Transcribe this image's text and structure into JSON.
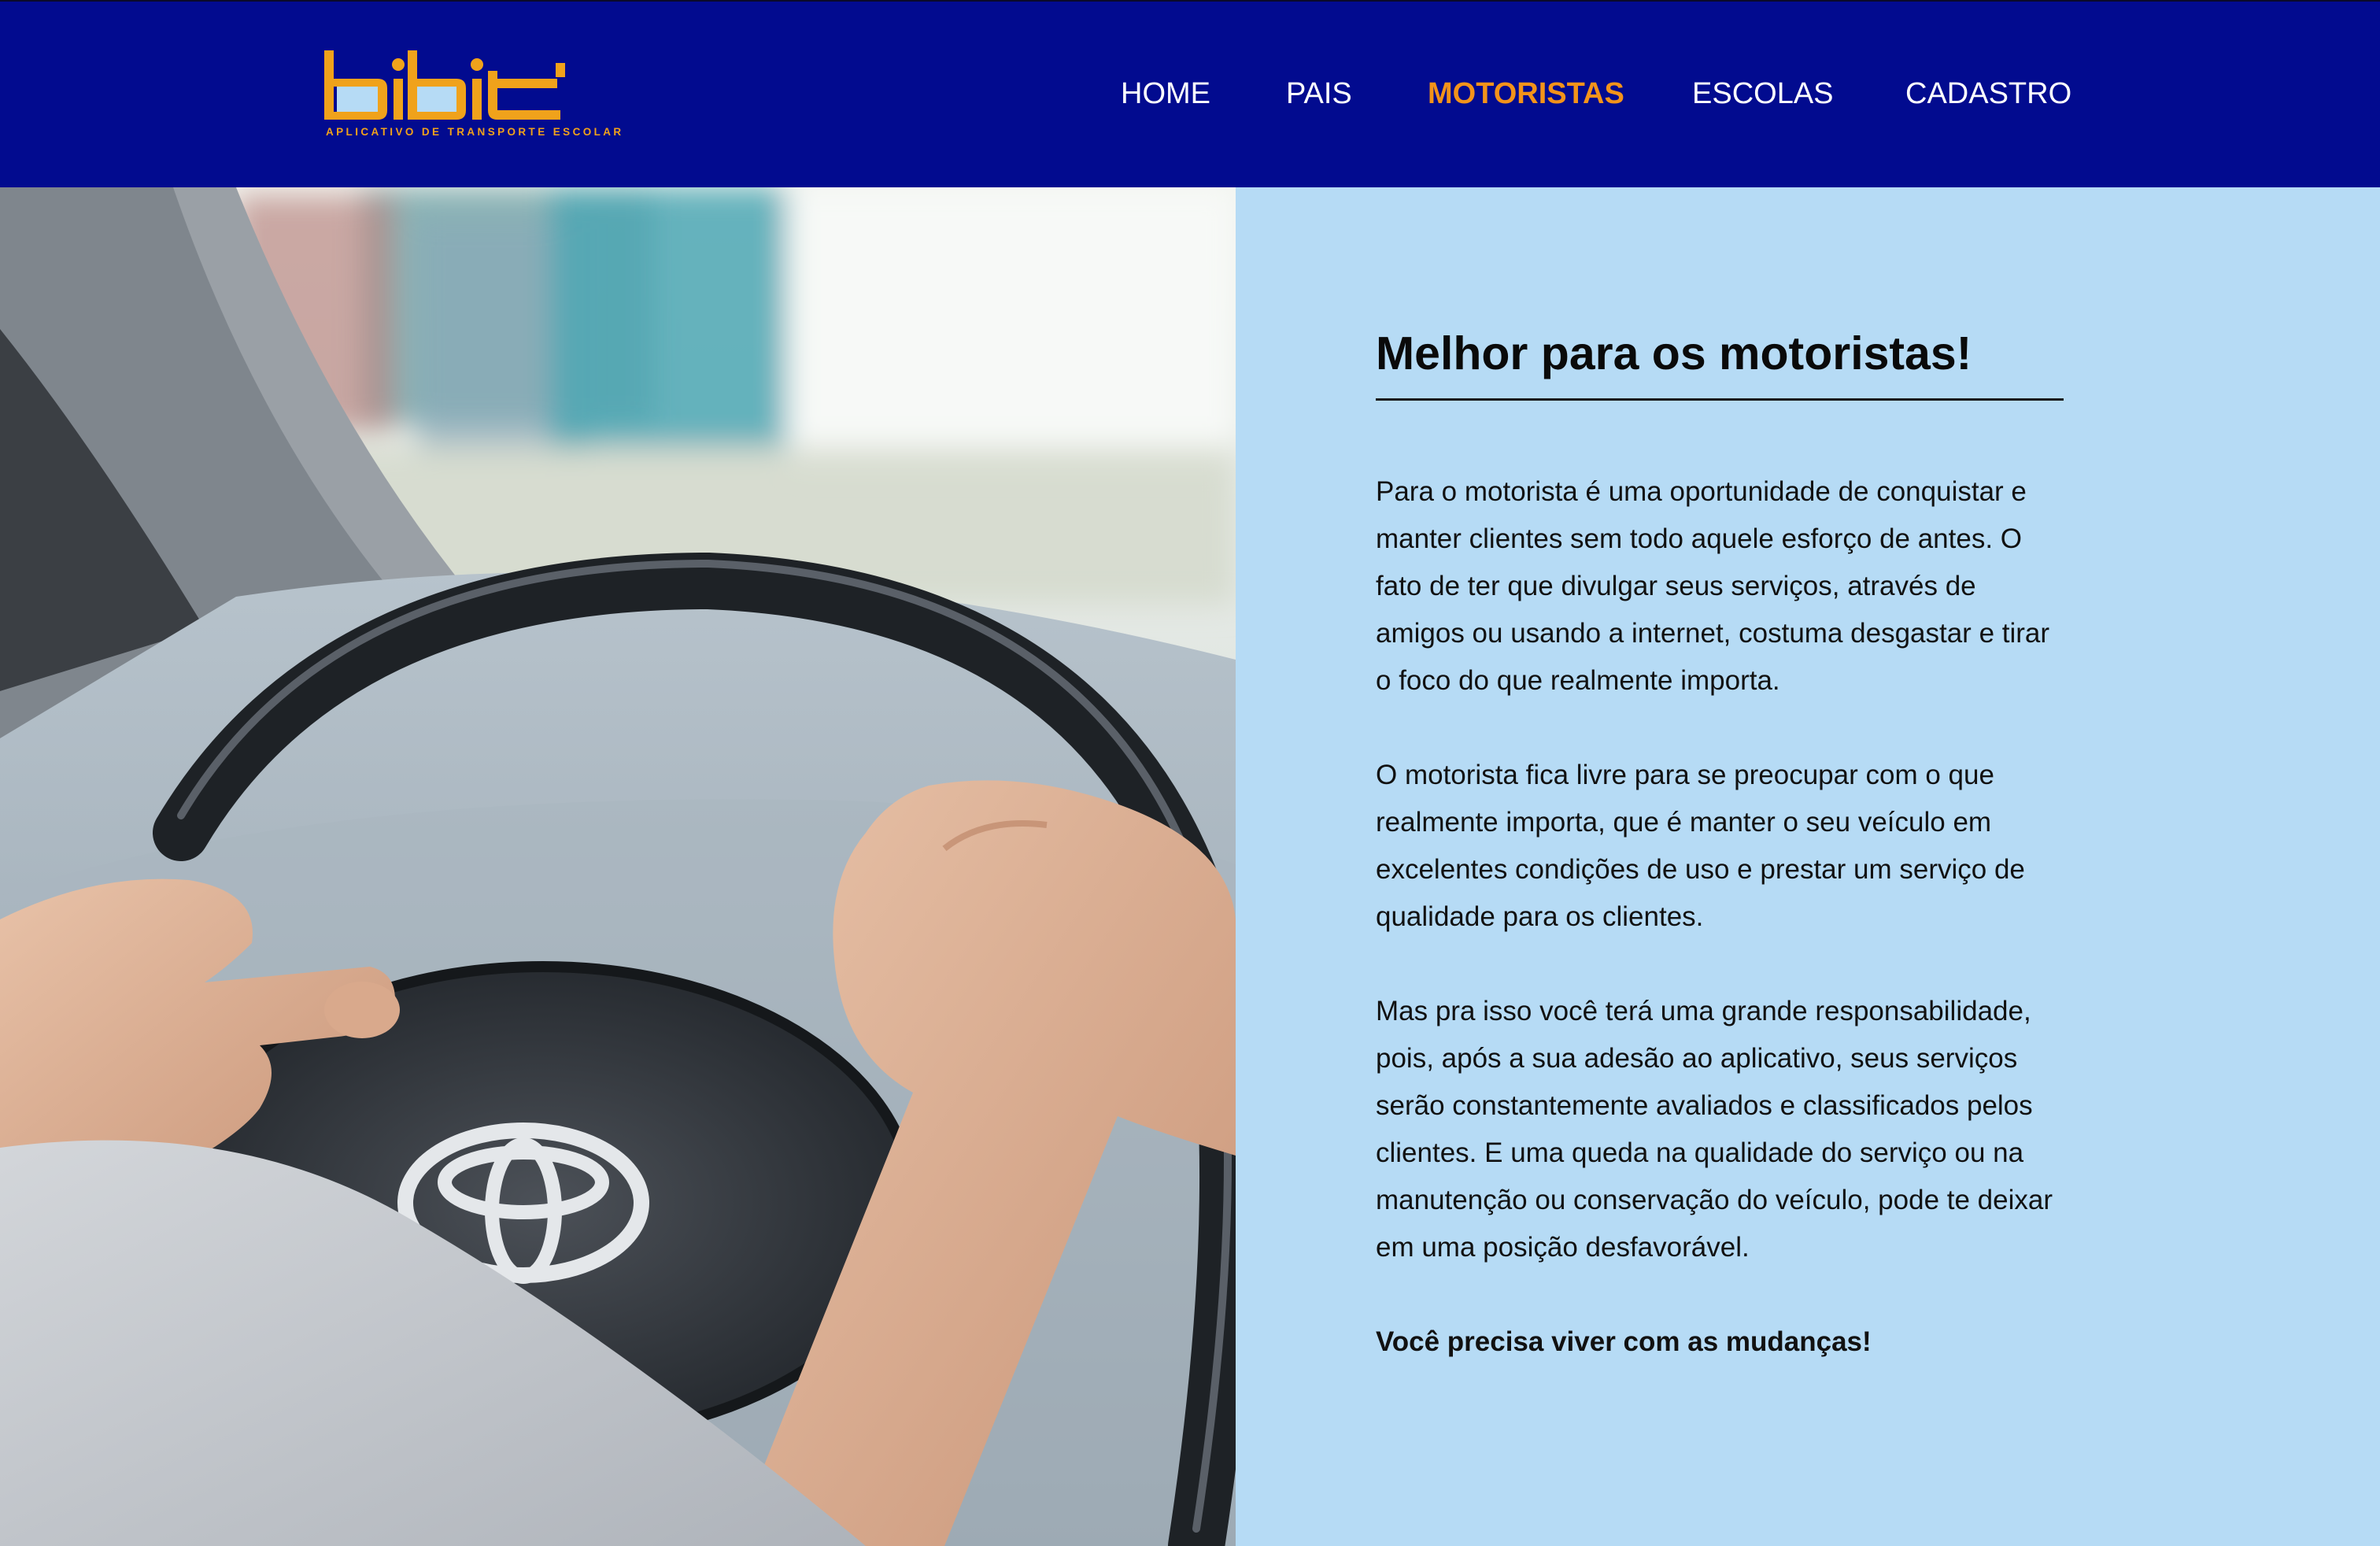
{
  "header": {
    "logo": {
      "wordmark": "bibit",
      "tagline": "APLICATIVO DE TRANSPORTE ESCOLAR",
      "accent_color": "#f0a21b",
      "tile_color": "#b6dbf5"
    },
    "background_color": "#020b8f",
    "nav": [
      {
        "label": "HOME",
        "active": false
      },
      {
        "label": "PAIS",
        "active": false
      },
      {
        "label": "MOTORISTAS",
        "active": true
      },
      {
        "label": "ESCOLAS",
        "active": false
      },
      {
        "label": "CADASTRO",
        "active": false
      }
    ],
    "active_color": "#f3931a"
  },
  "hero_image": {
    "description_icon": "steering-wheel-photo",
    "brand_emblem": "toyota-emblem"
  },
  "content": {
    "background_color": "#b6dbf5",
    "heading": "Melhor para os motoristas!",
    "paragraphs": [
      "Para o motorista é uma oportunidade de conquistar e manter clientes sem todo aquele esforço de antes. O fato de ter que divulgar seus serviços, através de amigos ou usando a internet, costuma desgastar e tirar o foco do que realmente importa.",
      "O motorista fica livre para se preocupar com o que realmente importa, que é manter o seu veículo em excelentes condições de uso e prestar um serviço de qualidade para os clientes.",
      "Mas pra isso você terá uma grande responsabilidade, pois, após a sua adesão ao aplicativo, seus serviços serão constantemente avaliados e classificados pelos clientes. E uma queda na qualidade do serviço ou na manutenção ou conservação do veículo, pode te deixar em uma posição desfavorável."
    ],
    "closing": "Você precisa viver com as mudanças!"
  }
}
